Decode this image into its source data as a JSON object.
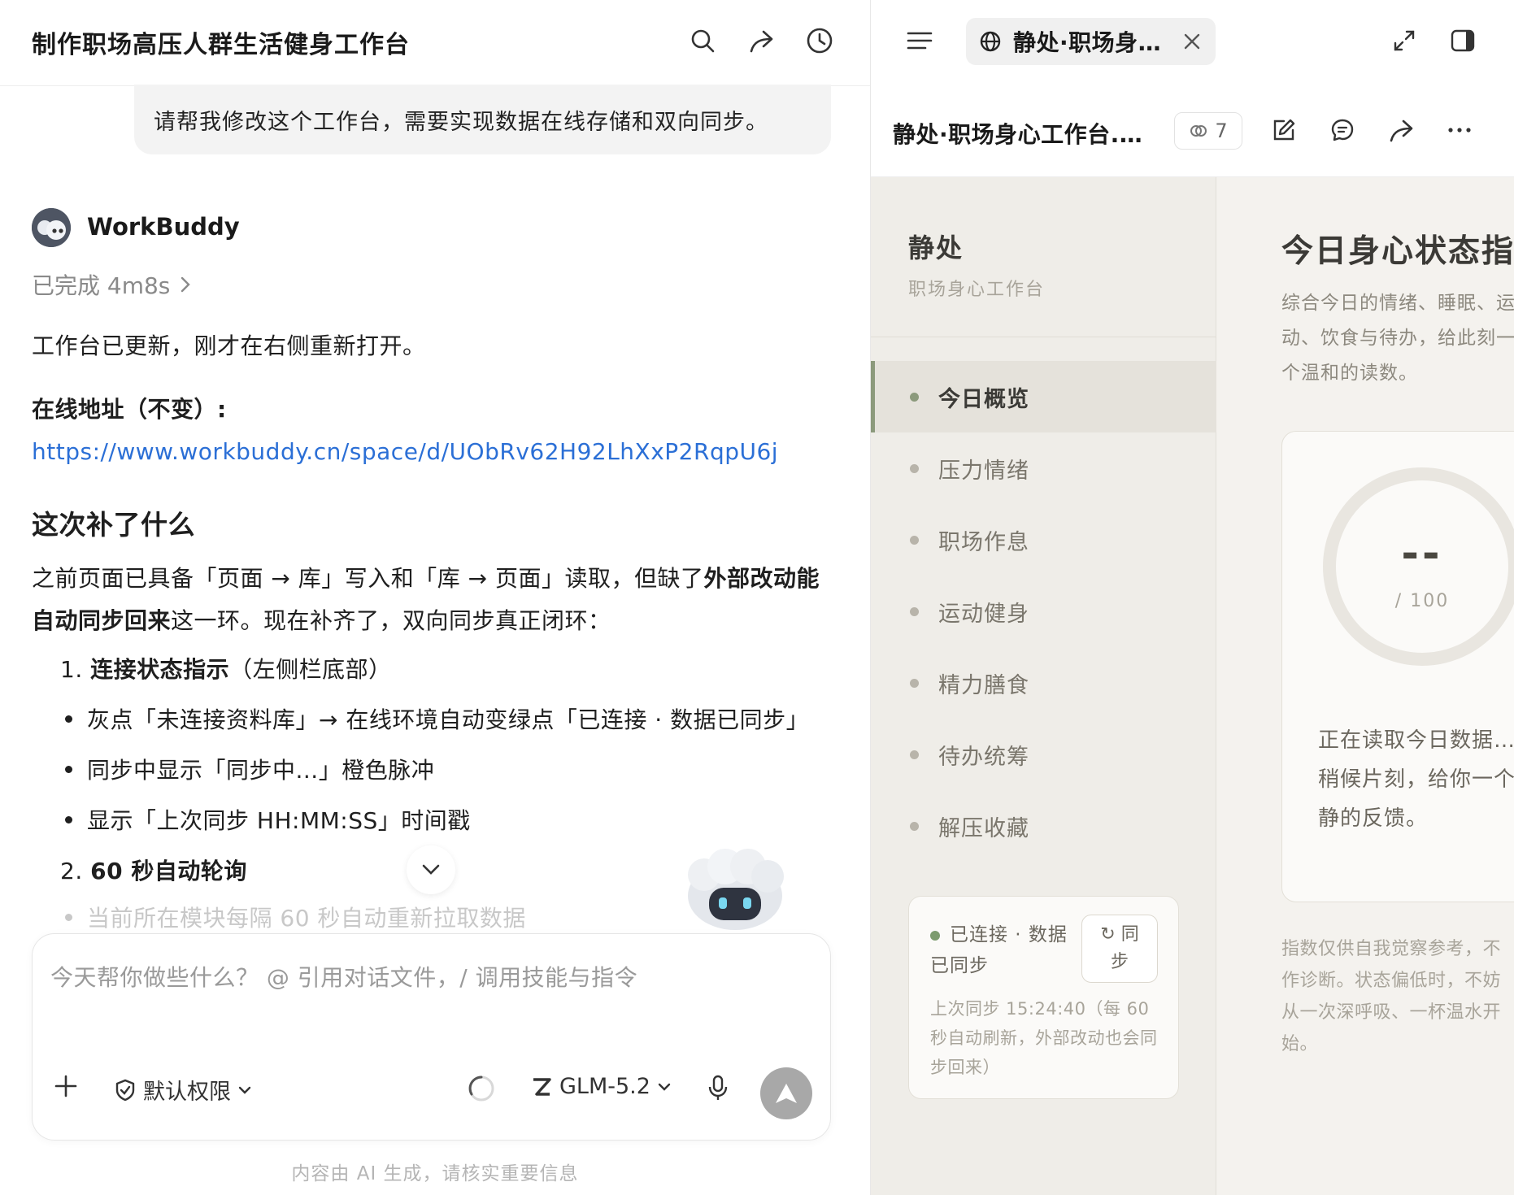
{
  "chat": {
    "title": "制作职场高压人群生活健身工作台",
    "user_message": "请帮我修改这个工作台，需要实现数据在线存储和双向同步。",
    "assistant_name": "WorkBuddy",
    "status": "已完成 4m8s",
    "intro": "工作台已更新，刚才在右侧重新打开。",
    "online_label": "在线地址（不变）:",
    "online_url": "https://www.workbuddy.cn/space/d/UObRv62H92LhXxP2RqpU6j",
    "section_title": "这次补了什么",
    "para_a": "之前页面已具备「页面 → 库」写入和「库 → 页面」读取，但缺了",
    "para_bold": "外部改动能自动同步回来",
    "para_b": "这一环。现在补齐了，双向同步真正闭环：",
    "item1_num": "1.",
    "item1_bold": "连接状态指示",
    "item1_rest": "（左侧栏底部）",
    "bullet1": "灰点「未连接资料库」→ 在线环境自动变绿点「已连接 · 数据已同步」",
    "bullet2": "同步中显示「同步中...」橙色脉冲",
    "bullet3": "显示「上次同步 HH:MM:SS」时间戳",
    "item2_num": "2.",
    "item2_bold": "60 秒自动轮询",
    "bullet4": "当前所在模块每隔 60 秒自动重新拉取数据",
    "composer_placeholder": "今天帮你做些什么？ @ 引用对话文件，/ 调用技能与指令",
    "permission_label": "默认权限",
    "model_label": "GLM-5.2",
    "footer_note": "内容由 AI 生成，请核实重要信息"
  },
  "preview_panel": {
    "tab_label": "静处·职场身心工作台.html",
    "file_title": "静处·职场身心工作台.html",
    "version_count": "7"
  },
  "app": {
    "brand": "静处",
    "subtitle": "职场身心工作台",
    "nav": [
      "今日概览",
      "压力情绪",
      "职场作息",
      "运动健身",
      "精力膳食",
      "待办统筹",
      "解压收藏"
    ],
    "active_nav": "今日概览",
    "sync_status": "已连接 · 数据已同步",
    "sync_button": "同步",
    "sync_meta": "上次同步 15:24:40（每 60 秒自动刷新，外部改动也会同步回来）",
    "page_title": "今日身心状态指数",
    "page_desc": "综合今日的情绪、睡眠、运动、饮食与待办，给此刻一个温和的读数。",
    "score_value": "--",
    "score_max": "/ 100",
    "loading_text": "正在读取今日数据……稍候片刻，给你一个安静的反馈。",
    "note": "指数仅供自我觉察参考，不作诊断。状态偏低时，不妨从一次深呼吸、一杯温水开始。"
  },
  "colors": {
    "link": "#2b6fd6",
    "accent_green": "#8c9a7c",
    "connected_dot": "#7c9b6e",
    "send_button": "#a8a8a8"
  }
}
